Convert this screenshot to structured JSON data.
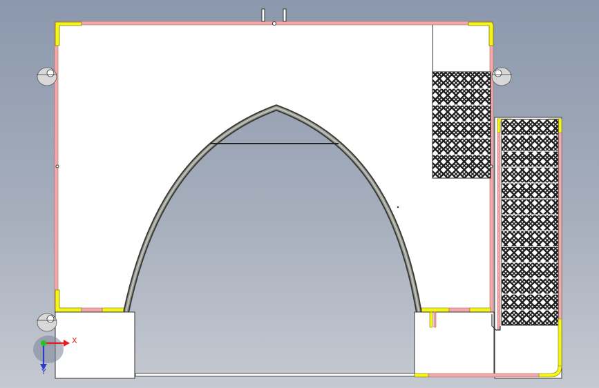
{
  "viewport": {
    "background_top": "#8b98ad",
    "background_bottom": "#c5c9d1"
  },
  "colors": {
    "frame_pink": "#f4a8a8",
    "corner_yellow": "#f5f51a",
    "arch_gray": "#8a8d86",
    "mesh_dark": "#1e1e1e",
    "triad_x": "#e81c1c",
    "triad_y": "#1ec81e",
    "triad_z": "#2a3cc8"
  },
  "triad": {
    "x_label": "X",
    "y_label": "Y"
  }
}
